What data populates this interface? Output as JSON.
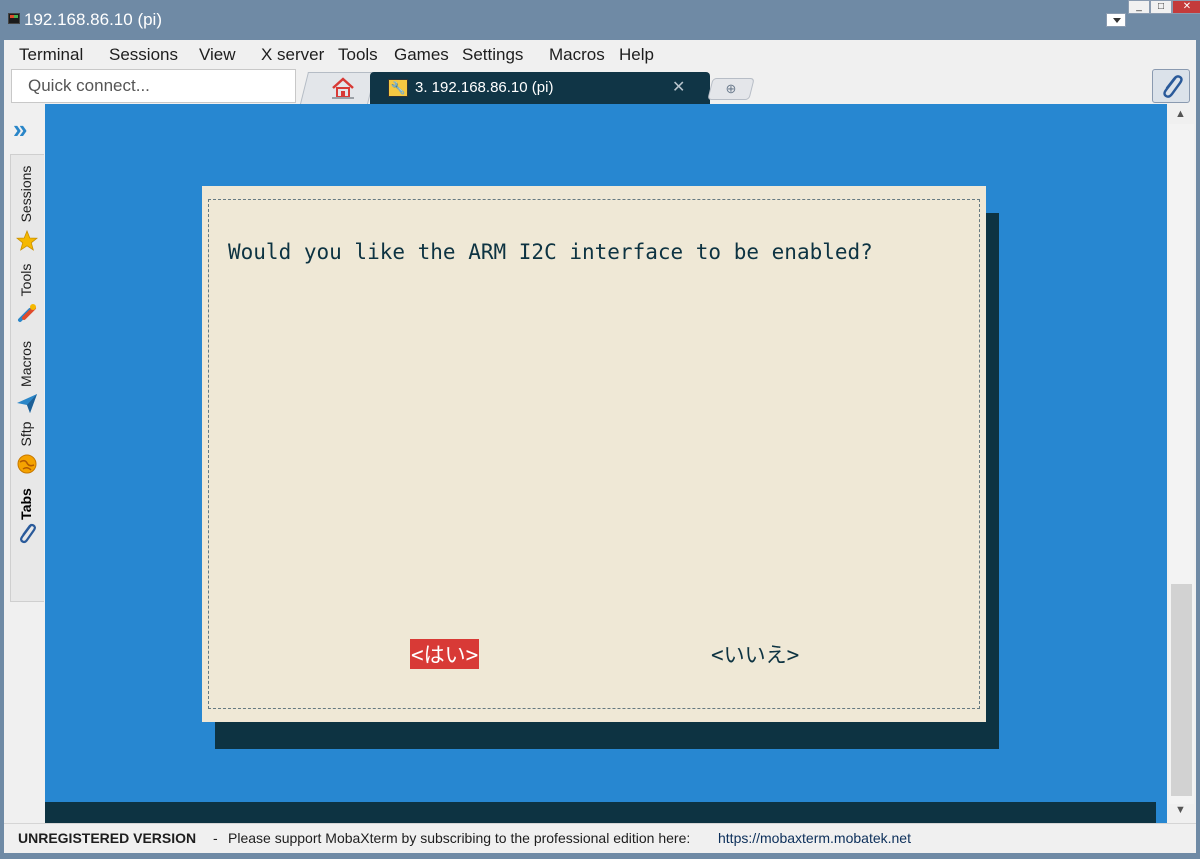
{
  "window": {
    "title": "192.168.86.10 (pi)",
    "minimize": "_",
    "maximize": "□",
    "close": "✕"
  },
  "menu": [
    "Terminal",
    "Sessions",
    "View",
    "X server",
    "Tools",
    "Games",
    "Settings",
    "Macros",
    "Help"
  ],
  "quick_connect": {
    "placeholder": "Quick connect..."
  },
  "tabs": {
    "home_icon": "home-icon",
    "active_label": "3. 192.168.86.10 (pi)",
    "close_glyph": "✕",
    "new_tab_glyph": "⊕"
  },
  "sidebar": {
    "toggle_glyph": "»",
    "items": [
      {
        "label": "Sessions",
        "icon": "star-icon",
        "color": "#f5b800"
      },
      {
        "label": "Tools",
        "icon": "tools-icon",
        "color": "#e04b2b"
      },
      {
        "label": "Macros",
        "icon": "paper-plane-icon",
        "color": "#2a86c8"
      },
      {
        "label": "Sftp",
        "icon": "globe-icon",
        "color": "#f5a300"
      },
      {
        "label": "Tabs",
        "icon": "paperclip-icon",
        "color": "#2a5a9a",
        "active": true
      }
    ]
  },
  "dialog": {
    "message": "Would you like the ARM I2C interface to be enabled?",
    "yes_label": "<はい>",
    "no_label": "<いいえ>"
  },
  "colors": {
    "terminal_bg": "#2787d1",
    "dialog_bg": "#efe8d6",
    "dialog_shadow": "#0d3342",
    "selected_button": "#d83a36"
  },
  "status": {
    "unregistered": "UNREGISTERED VERSION",
    "separator": "-",
    "message": "Please support MobaXterm by subscribing to the professional edition here:",
    "link": "https://mobaxterm.mobatek.net"
  }
}
